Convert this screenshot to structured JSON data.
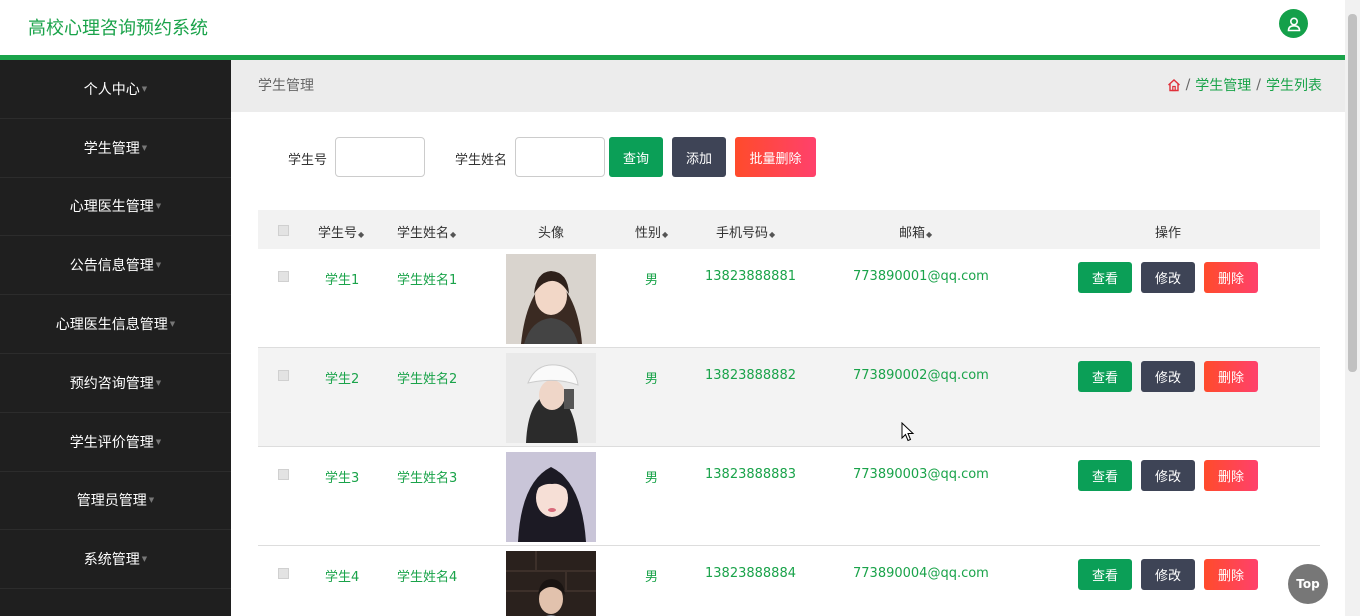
{
  "app": {
    "title": "高校心理咨询预约系统"
  },
  "sidebar": {
    "items": [
      {
        "label": "个人中心"
      },
      {
        "label": "学生管理"
      },
      {
        "label": "心理医生管理"
      },
      {
        "label": "公告信息管理"
      },
      {
        "label": "心理医生信息管理"
      },
      {
        "label": "预约咨询管理"
      },
      {
        "label": "学生评价管理"
      },
      {
        "label": "管理员管理"
      },
      {
        "label": "系统管理"
      }
    ]
  },
  "page": {
    "title": "学生管理",
    "breadcrumb": [
      "学生管理",
      "学生列表"
    ]
  },
  "search": {
    "student_no_label": "学生号",
    "student_no_value": "",
    "student_name_label": "学生姓名",
    "student_name_value": "",
    "query_label": "查询",
    "add_label": "添加",
    "batch_delete_label": "批量删除"
  },
  "table": {
    "headers": {
      "student_no": "学生号",
      "student_name": "学生姓名",
      "avatar": "头像",
      "gender": "性别",
      "phone": "手机号码",
      "email": "邮箱",
      "actions": "操作"
    },
    "rows": [
      {
        "student_no": "学生1",
        "student_name": "学生姓名1",
        "gender": "男",
        "phone": "13823888881",
        "email": "773890001@qq.com"
      },
      {
        "student_no": "学生2",
        "student_name": "学生姓名2",
        "gender": "男",
        "phone": "13823888882",
        "email": "773890002@qq.com"
      },
      {
        "student_no": "学生3",
        "student_name": "学生姓名3",
        "gender": "男",
        "phone": "13823888883",
        "email": "773890003@qq.com"
      },
      {
        "student_no": "学生4",
        "student_name": "学生姓名4",
        "gender": "男",
        "phone": "13823888884",
        "email": "773890004@qq.com"
      }
    ],
    "action_labels": {
      "view": "查看",
      "edit": "修改",
      "delete": "删除"
    }
  },
  "back_to_top": "Top",
  "colors": {
    "accent": "#1aa34a",
    "sidebar_bg": "#1f1f1f",
    "btn_dark": "#3e4456",
    "btn_red": "#ff416c"
  }
}
